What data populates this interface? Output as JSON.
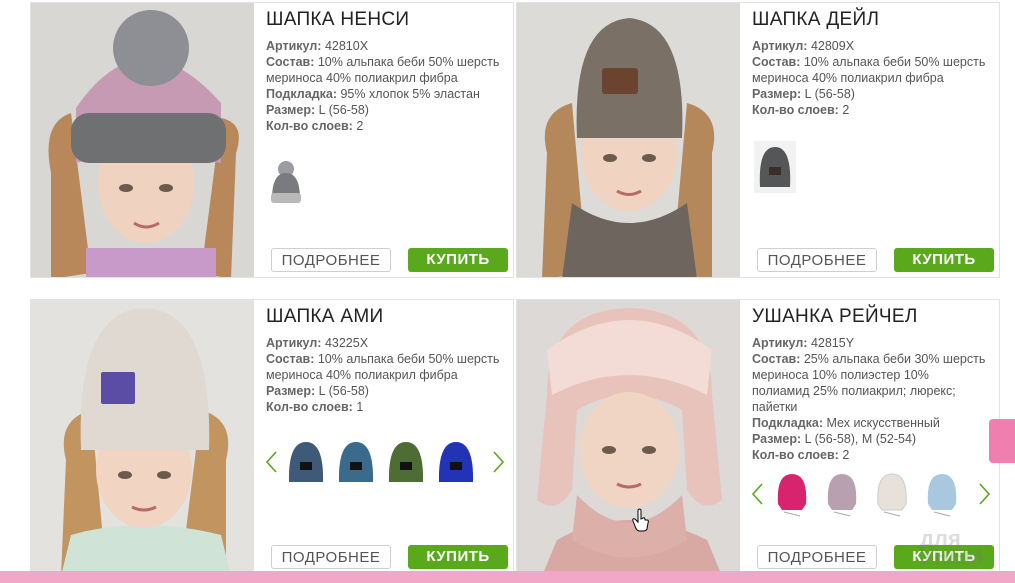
{
  "products": [
    {
      "title": "ШАПКА НЕНСИ",
      "props": [
        {
          "label": "Артикул:",
          "value": "42810X"
        },
        {
          "label": "Состав:",
          "value": "10% альпака беби 50% шерсть мериноса 40% полиакрил фибра"
        },
        {
          "label": "Подкладка:",
          "value": "95% хлопок 5% эластан"
        },
        {
          "label": "Размер:",
          "value": "L (56-58)"
        },
        {
          "label": "Кол-во слоев:",
          "value": "2"
        }
      ],
      "more_label": "ПОДРОБНЕЕ",
      "buy_label": "КУПИТЬ",
      "colors": {
        "hat_top": "#c69ab3",
        "hat_band": "#6f7072",
        "pompom": "#8d8f94"
      }
    },
    {
      "title": "ШАПКА ДЕЙЛ",
      "props": [
        {
          "label": "Артикул:",
          "value": "42809X"
        },
        {
          "label": "Состав:",
          "value": "10% альпака беби 50% шерсть мериноса 40% полиакрил фибра"
        },
        {
          "label": "Размер:",
          "value": "L (56-58)"
        },
        {
          "label": "Кол-во слоев:",
          "value": "2"
        }
      ],
      "more_label": "ПОДРОБНЕЕ",
      "buy_label": "КУПИТЬ",
      "colors": {
        "hat": "#7b7065"
      }
    },
    {
      "title": "ШАПКА АМИ",
      "props": [
        {
          "label": "Артикул:",
          "value": "43225X"
        },
        {
          "label": "Состав:",
          "value": "10% альпака беби 50% шерсть мериноса 40% полиакрил фибра"
        },
        {
          "label": "Размер:",
          "value": "L (56-58)"
        },
        {
          "label": "Кол-во слоев:",
          "value": "1"
        }
      ],
      "more_label": "ПОДРОБНЕЕ",
      "buy_label": "КУПИТЬ",
      "colors": {
        "hat": "#e0d9d2"
      },
      "variant_colors": [
        "#3f5a78",
        "#3a6a8c",
        "#4e6d35",
        "#2233b8"
      ]
    },
    {
      "title": "УШАНКА РЕЙЧЕЛ",
      "props": [
        {
          "label": "Артикул:",
          "value": "42815Y"
        },
        {
          "label": "Состав:",
          "value": "25% альпака беби 30% шерсть мериноса 10% полиэстер 10% полиамид 25% полиакрил; люрекс; пайетки"
        },
        {
          "label": "Подкладка:",
          "value": "Мех искусственный"
        },
        {
          "label": "Размер:",
          "value": "L (56-58), M (52-54)"
        },
        {
          "label": "Кол-во слоев:",
          "value": "2"
        }
      ],
      "more_label": "ПОДРОБНЕЕ",
      "buy_label": "КУПИТЬ",
      "colors": {
        "hat": "#e8c3bb"
      },
      "variant_colors": [
        "#d8246e",
        "#b9a0b0",
        "#e8e1d9",
        "#a9c8e0"
      ]
    }
  ],
  "watermark": "для УНЕМ",
  "colors": {
    "accent_green": "#5aa81c",
    "accent_pink": "#f2a7c8",
    "border": "#e2e2e2"
  },
  "icons": [
    "chevron-left-icon",
    "chevron-right-icon",
    "hand-cursor-icon"
  ]
}
